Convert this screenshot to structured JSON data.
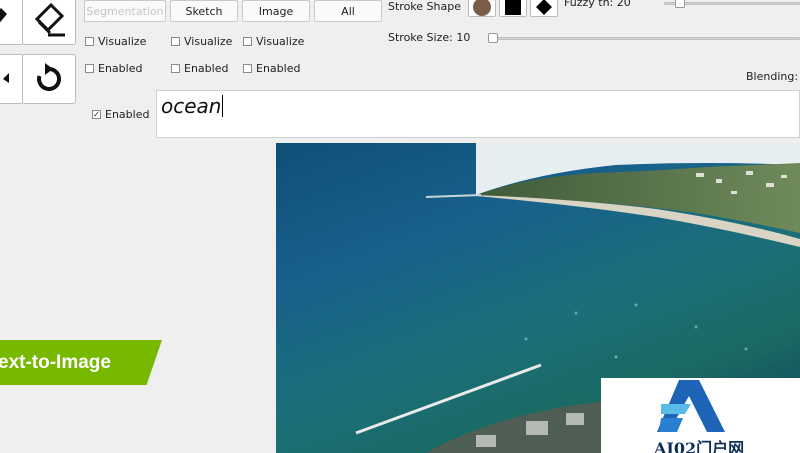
{
  "modes": {
    "segmentation": "Segmentation",
    "sketch": "Sketch",
    "image": "Image",
    "all": "All"
  },
  "checkboxes": {
    "visualize": "Visualize",
    "enabled": "Enabled"
  },
  "stroke": {
    "shape_label": "Stroke Shape",
    "size_label": "Stroke Size: 10",
    "size_value": 10,
    "color": "#7a5c4a"
  },
  "fuzzy": {
    "label": "Fuzzy th: 20",
    "value": 20
  },
  "blending": {
    "label": "Blending:"
  },
  "text_prompt": {
    "enabled_label": "Enabled",
    "value": "ocean"
  },
  "banner": {
    "text": "ext-to-Image",
    "color": "#76b900"
  },
  "watermark": {
    "text": "AI02门户网"
  }
}
